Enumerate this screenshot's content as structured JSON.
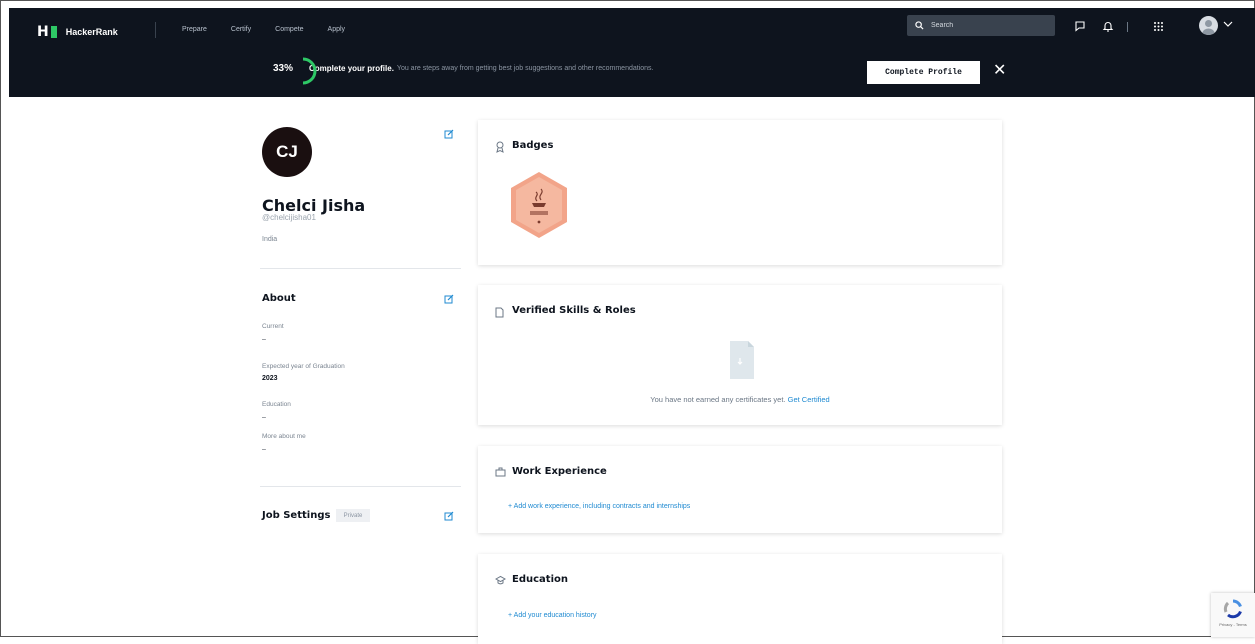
{
  "header": {
    "logo_text": "HackerRank",
    "nav": [
      "Prepare",
      "Certify",
      "Compete",
      "Apply"
    ],
    "search_placeholder": "Search",
    "accent_color": "#2ec866",
    "bg_color": "#0e141e"
  },
  "banner": {
    "percent": "33%",
    "progress": 0.33,
    "title": "Complete your profile.",
    "text": "You are steps away from getting best job suggestions and other recommendations.",
    "button_label": "Complete Profile",
    "close_glyph": "✕"
  },
  "profile": {
    "initials": "CJ",
    "name": "Chelci Jisha",
    "handle": "@chelcijisha01",
    "country": "India"
  },
  "about": {
    "title": "About",
    "fields": [
      {
        "label": "Current",
        "value": "–"
      },
      {
        "label": "Expected year of Graduation",
        "value": "2023"
      },
      {
        "label": "Education",
        "value": "–"
      },
      {
        "label": "More about me",
        "value": "–"
      }
    ]
  },
  "job_settings": {
    "title": "Job Settings",
    "badge": "Private"
  },
  "badges": {
    "title": "Badges",
    "items": [
      {
        "name": "Java",
        "color": "#f2a489"
      }
    ]
  },
  "verified": {
    "title": "Verified Skills & Roles",
    "empty_text": "You have not earned any certificates yet.",
    "link": "Get Certified"
  },
  "work": {
    "title": "Work Experience",
    "link": "+ Add work experience, including contracts and internships"
  },
  "education": {
    "title": "Education",
    "link": "+ Add your education history"
  },
  "recaptcha": {
    "text": "Privacy - Terms"
  }
}
